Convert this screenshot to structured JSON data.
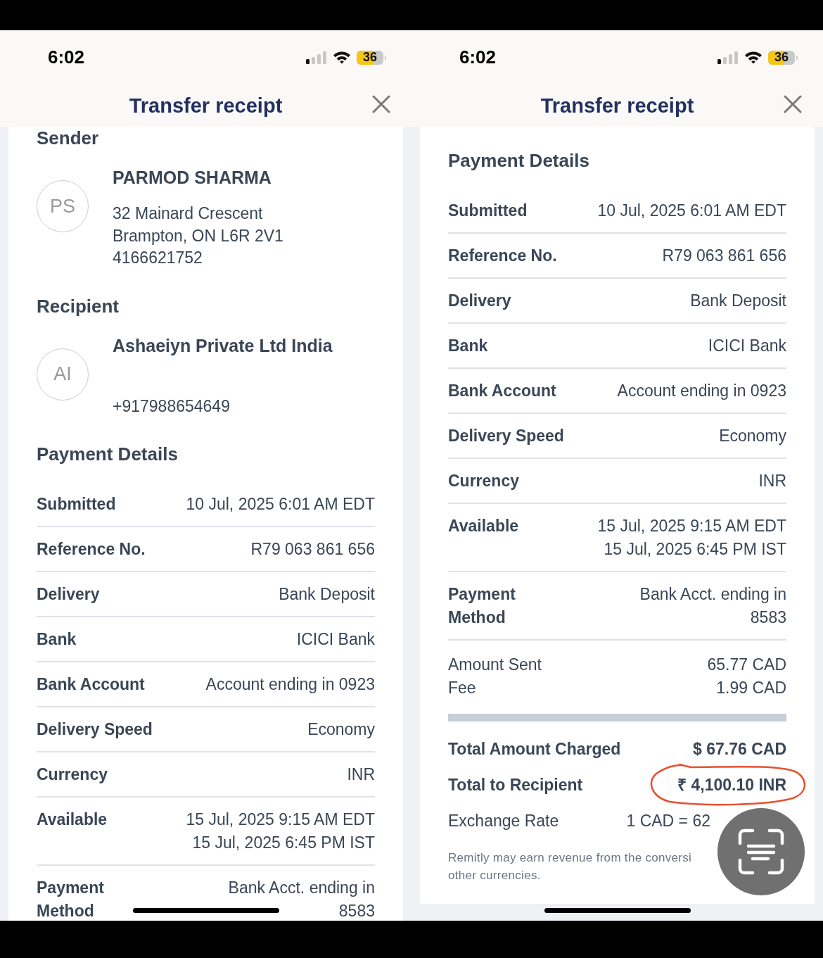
{
  "phones": [
    {
      "status_bar": {
        "time": "6:02",
        "battery": "36"
      },
      "title": "Transfer receipt",
      "scrolled": true,
      "content": [
        {
          "kind": "heading",
          "text": "Sender"
        },
        {
          "kind": "party",
          "initials": "PS",
          "name": "PARMOD SHARMA",
          "lines": [
            "32 Mainard Crescent",
            "Brampton, ON L6R 2V1",
            "4166621752"
          ]
        },
        {
          "kind": "heading",
          "text": "Recipient"
        },
        {
          "kind": "party",
          "initials": "AI",
          "name": "Ashaeiyn Private Ltd India",
          "lines": [
            "+917988654649"
          ]
        },
        {
          "kind": "heading",
          "text": "Payment Details"
        },
        {
          "kind": "detail",
          "label": "Submitted",
          "values": [
            "10 Jul, 2025 6:01 AM EDT"
          ]
        },
        {
          "kind": "detail",
          "label": "Reference No.",
          "values": [
            "R79 063 861 656"
          ]
        },
        {
          "kind": "detail",
          "label": "Delivery",
          "values": [
            "Bank Deposit"
          ]
        },
        {
          "kind": "detail",
          "label": "Bank",
          "values": [
            "ICICI Bank"
          ]
        },
        {
          "kind": "detail",
          "label": "Bank Account",
          "values": [
            "Account ending in 0923"
          ]
        },
        {
          "kind": "detail",
          "label": "Delivery Speed",
          "values": [
            "Economy"
          ]
        },
        {
          "kind": "detail",
          "label": "Currency",
          "values": [
            "INR"
          ]
        },
        {
          "kind": "detail",
          "label": "Available",
          "values": [
            "15 Jul, 2025 9:15 AM EDT",
            "15 Jul, 2025 6:45 PM IST"
          ]
        },
        {
          "kind": "detail",
          "label": "Payment Method",
          "values": [
            "Bank Acct. ending in",
            "8583"
          ]
        }
      ]
    },
    {
      "status_bar": {
        "time": "6:02",
        "battery": "36"
      },
      "title": "Transfer receipt",
      "scrolled": false,
      "content": [
        {
          "kind": "heading",
          "text": "Payment Details"
        },
        {
          "kind": "detail",
          "label": "Submitted",
          "values": [
            "10 Jul, 2025 6:01 AM EDT"
          ]
        },
        {
          "kind": "detail",
          "label": "Reference No.",
          "values": [
            "R79 063 861 656"
          ]
        },
        {
          "kind": "detail",
          "label": "Delivery",
          "values": [
            "Bank Deposit"
          ]
        },
        {
          "kind": "detail",
          "label": "Bank",
          "values": [
            "ICICI Bank"
          ]
        },
        {
          "kind": "detail",
          "label": "Bank Account",
          "values": [
            "Account ending in 0923"
          ]
        },
        {
          "kind": "detail",
          "label": "Delivery Speed",
          "values": [
            "Economy"
          ]
        },
        {
          "kind": "detail",
          "label": "Currency",
          "values": [
            "INR"
          ]
        },
        {
          "kind": "detail",
          "label": "Available",
          "values": [
            "15 Jul, 2025 9:15 AM EDT",
            "15 Jul, 2025 6:45 PM IST"
          ]
        },
        {
          "kind": "detail",
          "label": "Payment Method",
          "values": [
            "Bank Acct. ending in",
            "8583"
          ]
        },
        {
          "kind": "amounts",
          "rows": [
            {
              "label": "Amount Sent",
              "value": "65.77 CAD"
            },
            {
              "label": "Fee",
              "value": "1.99 CAD"
            }
          ]
        },
        {
          "kind": "bar"
        },
        {
          "kind": "total",
          "label": "Total Amount Charged",
          "value": "$ 67.76 CAD",
          "highlighted": false
        },
        {
          "kind": "total",
          "label": "Total to Recipient",
          "value": "₹ 4,100.10 INR",
          "highlighted": true
        },
        {
          "kind": "rate",
          "label": "Exchange Rate",
          "value": "1 CAD = 62"
        },
        {
          "kind": "note",
          "lines": [
            "Remitly may earn revenue from the conversi",
            "other currencies."
          ]
        }
      ],
      "scan_button": true
    }
  ]
}
